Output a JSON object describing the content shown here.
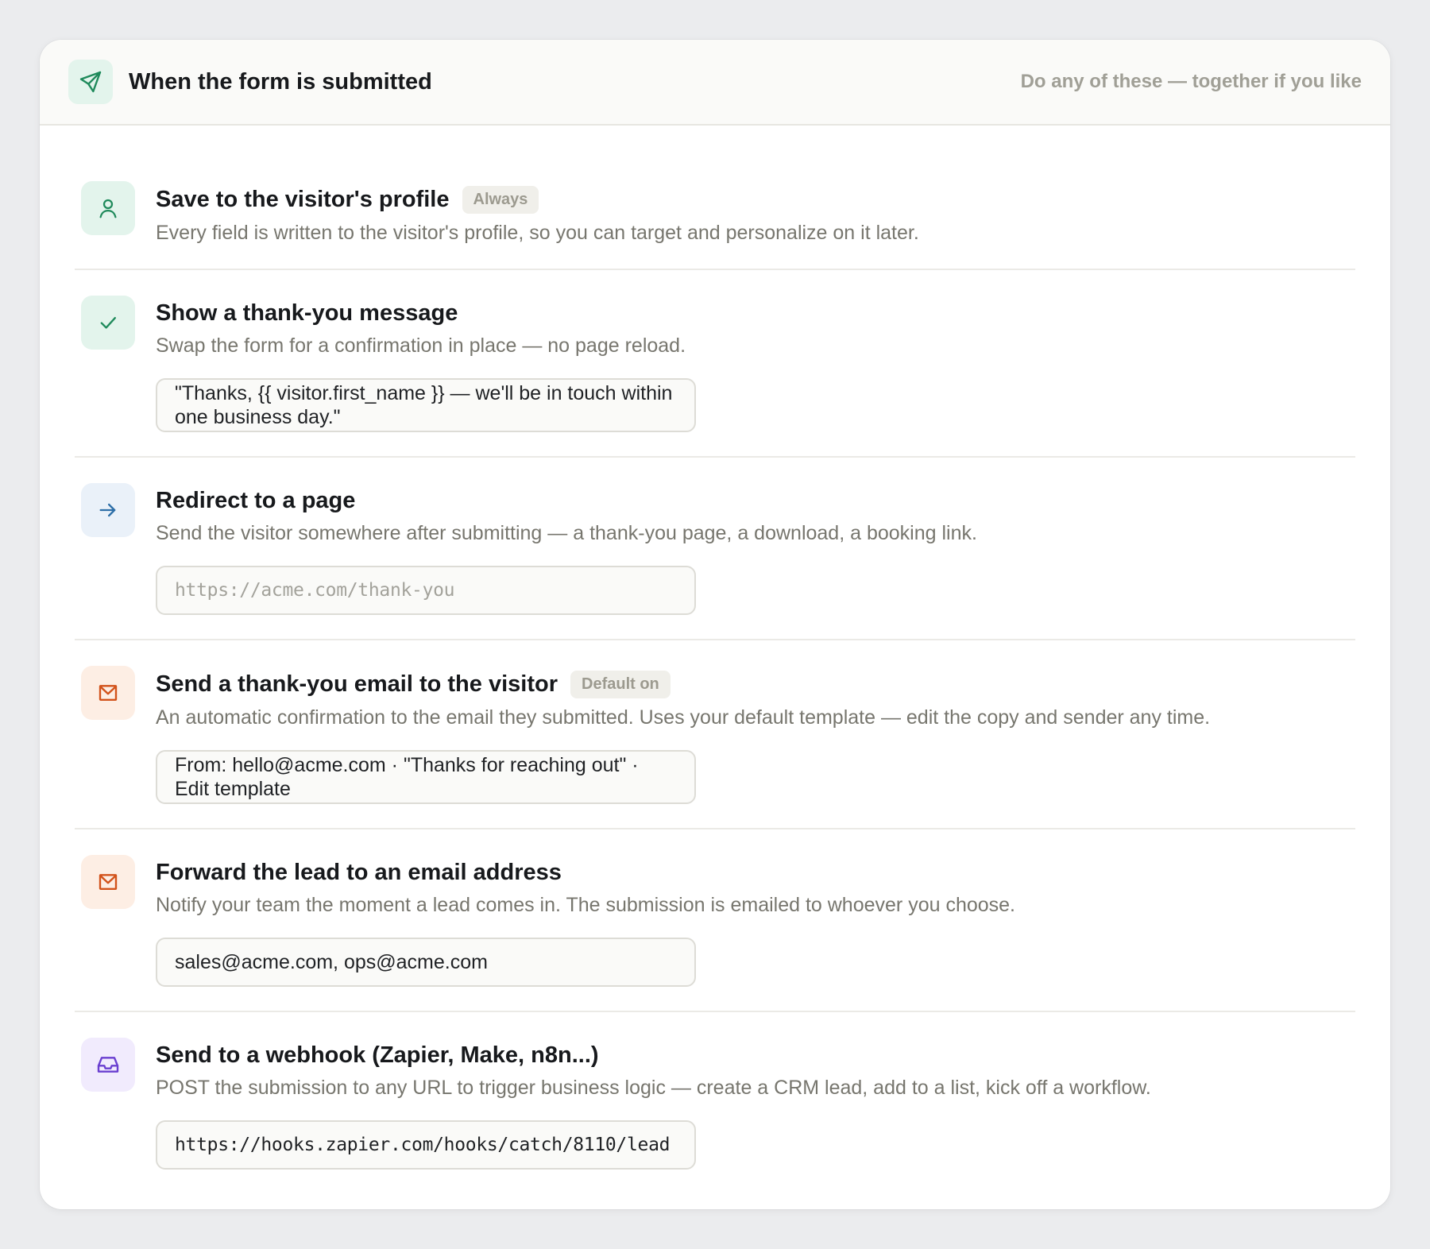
{
  "header": {
    "title": "When the form is submitted",
    "hint": "Do any of these — together if you like",
    "icon": "send-icon"
  },
  "colors": {
    "green": "#1f8a5b",
    "blue": "#2e6fa8",
    "orange": "#d2531b",
    "purple": "#6a3fd0"
  },
  "actions": [
    {
      "title": "Save to the visitor's profile",
      "badge": "Always",
      "description": "Every field is written to the visitor's profile, so you can target and personalize on it later.",
      "icon": "user-icon"
    },
    {
      "title": "Show a thank-you message",
      "description": "Swap the form for a confirmation in place — no page reload.",
      "field_value": "\"Thanks, {{ visitor.first_name }} — we'll be in touch within one business day.\"",
      "icon": "check-icon"
    },
    {
      "title": "Redirect to a page",
      "description": "Send the visitor somewhere after submitting — a thank-you page, a download, a booking link.",
      "field_placeholder": "https://acme.com/thank-you",
      "icon": "arrow-right-icon"
    },
    {
      "title": "Send a thank-you email to the visitor",
      "badge": "Default on",
      "description": "An automatic confirmation to the email they submitted. Uses your default template — edit the copy and sender any time.",
      "field_value": "From: hello@acme.com · \"Thanks for reaching out\" · Edit template",
      "icon": "mail-icon"
    },
    {
      "title": "Forward the lead to an email address",
      "description": "Notify your team the moment a lead comes in. The submission is emailed to whoever you choose.",
      "field_value": "sales@acme.com, ops@acme.com",
      "icon": "mail-icon"
    },
    {
      "title": "Send to a webhook (Zapier, Make, n8n...)",
      "description": "POST the submission to any URL to trigger business logic — create a CRM lead, add to a list, kick off a workflow.",
      "field_value": "https://hooks.zapier.com/hooks/catch/8110/lead",
      "icon": "inbox-icon"
    }
  ]
}
